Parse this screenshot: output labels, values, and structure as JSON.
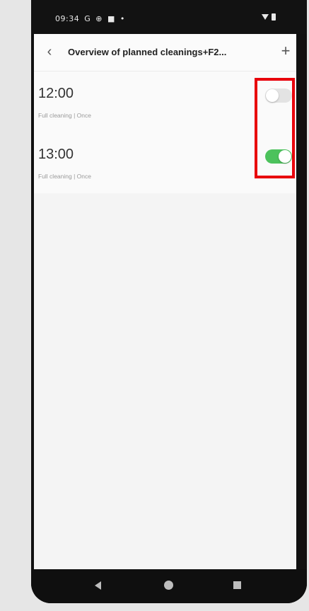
{
  "status_bar": {
    "time": "09:34",
    "icons_left": [
      "G",
      "⊕",
      "■",
      "•"
    ]
  },
  "header": {
    "back_icon": "‹",
    "title": "Overview of planned cleanings+F2...",
    "add_icon": "+"
  },
  "schedules": [
    {
      "time": "12:00",
      "subtitle": "Full cleaning | Once",
      "enabled": false
    },
    {
      "time": "13:00",
      "subtitle": "Full cleaning | Once",
      "enabled": true
    }
  ],
  "colors": {
    "toggle_on": "#4cc25c",
    "toggle_off": "#e3e3e3",
    "highlight": "#e8000b"
  },
  "nav_bar": {
    "icons": [
      "back-icon",
      "home-icon",
      "recents-icon"
    ]
  }
}
